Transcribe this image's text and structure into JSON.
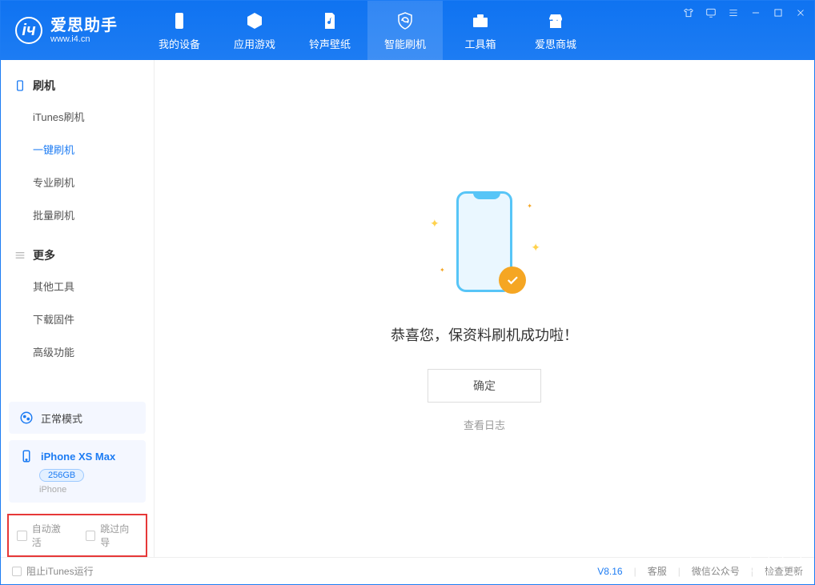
{
  "brand": {
    "name": "爱思助手",
    "url": "www.i4.cn"
  },
  "nav": {
    "items": [
      {
        "label": "我的设备"
      },
      {
        "label": "应用游戏"
      },
      {
        "label": "铃声壁纸"
      },
      {
        "label": "智能刷机"
      },
      {
        "label": "工具箱"
      },
      {
        "label": "爱思商城"
      }
    ]
  },
  "sidebar": {
    "flash": {
      "title": "刷机",
      "items": [
        {
          "label": "iTunes刷机"
        },
        {
          "label": "一键刷机"
        },
        {
          "label": "专业刷机"
        },
        {
          "label": "批量刷机"
        }
      ]
    },
    "more": {
      "title": "更多",
      "items": [
        {
          "label": "其他工具"
        },
        {
          "label": "下载固件"
        },
        {
          "label": "高级功能"
        }
      ]
    }
  },
  "mode": {
    "label": "正常模式"
  },
  "device": {
    "name": "iPhone XS Max",
    "storage": "256GB",
    "type": "iPhone"
  },
  "options": {
    "auto_activate": "自动激活",
    "skip_guide": "跳过向导"
  },
  "main": {
    "success": "恭喜您，保资料刷机成功啦！",
    "ok": "确定",
    "view_log": "查看日志"
  },
  "statusbar": {
    "block_itunes": "阻止iTunes运行",
    "version": "V8.16",
    "support": "客服",
    "wechat": "微信公众号",
    "update": "检查更新"
  }
}
